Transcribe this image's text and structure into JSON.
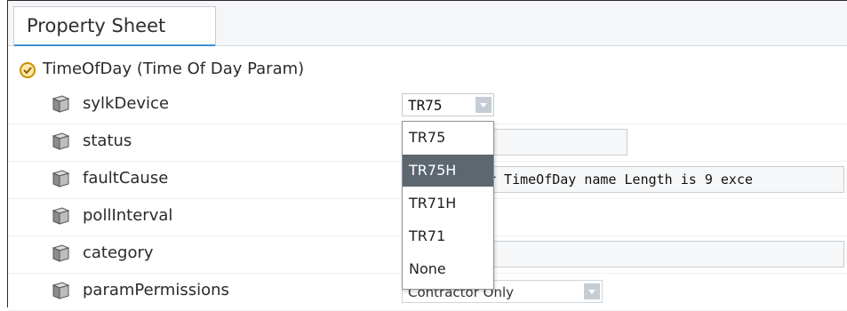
{
  "tab": {
    "label": "Property Sheet"
  },
  "header": {
    "label": "TimeOfDay  (Time Of Day Param)"
  },
  "rows": [
    {
      "name": "sylkDevice",
      "value": "TR75"
    },
    {
      "name": "status",
      "value": ""
    },
    {
      "name": "faultCause",
      "value": "r TimeOfDay name Length is 9 exce"
    },
    {
      "name": "pollInterval",
      "value": ""
    },
    {
      "name": "category",
      "value": ""
    },
    {
      "name": "paramPermissions",
      "value": "Contractor Only"
    }
  ],
  "dropdown": {
    "options": [
      "TR75",
      "TR75H",
      "TR71H",
      "TR71",
      "None"
    ],
    "highlighted": "TR75H"
  },
  "colors": {
    "accent": "#3a8fd6",
    "highlight": "#5d6770",
    "header_icon": "#e0a800"
  },
  "icons": {
    "header": "clock-status-icon",
    "property": "cube-icon"
  }
}
